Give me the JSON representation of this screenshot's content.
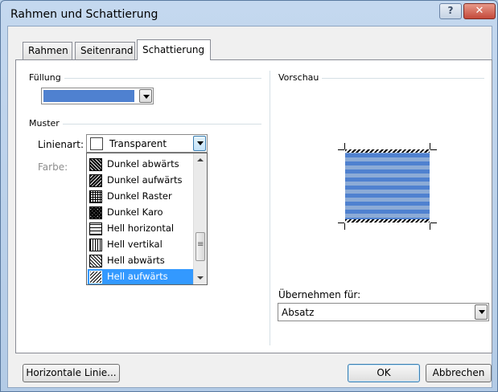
{
  "window": {
    "title": "Rahmen und Schattierung",
    "help_glyph": "?",
    "close_glyph": "✕"
  },
  "tabs": [
    {
      "label": "Rahmen",
      "active": false
    },
    {
      "label": "Seitenrand",
      "active": false
    },
    {
      "label": "Schattierung",
      "active": true
    }
  ],
  "fill": {
    "title": "Füllung",
    "color": "#4f81d0"
  },
  "pattern": {
    "title": "Muster",
    "style_label": "Linienart:",
    "style_value": "Transparent",
    "color_label": "Farbe:",
    "options": [
      {
        "label": "Dunkel abwärts",
        "icon": "dark-down-diagonal-pattern-icon",
        "selected": false
      },
      {
        "label": "Dunkel aufwärts",
        "icon": "dark-up-diagonal-pattern-icon",
        "selected": false
      },
      {
        "label": "Dunkel Raster",
        "icon": "dark-grid-pattern-icon",
        "selected": false
      },
      {
        "label": "Dunkel Karo",
        "icon": "dark-trellis-pattern-icon",
        "selected": false
      },
      {
        "label": "Hell horizontal",
        "icon": "light-horizontal-pattern-icon",
        "selected": false
      },
      {
        "label": "Hell vertikal",
        "icon": "light-vertical-pattern-icon",
        "selected": false
      },
      {
        "label": "Hell abwärts",
        "icon": "light-down-diagonal-pattern-icon",
        "selected": false
      },
      {
        "label": "Hell aufwärts",
        "icon": "light-up-diagonal-pattern-icon",
        "selected": true
      }
    ]
  },
  "preview": {
    "title": "Vorschau",
    "apply_label": "Übernehmen für:",
    "apply_value": "Absatz"
  },
  "buttons": {
    "horizontal_line": "Horizontale Linie...",
    "ok": "OK",
    "cancel": "Abbrechen"
  },
  "colors": {
    "fill_blue": "#4f81d0",
    "selection_blue": "#3399ff"
  }
}
